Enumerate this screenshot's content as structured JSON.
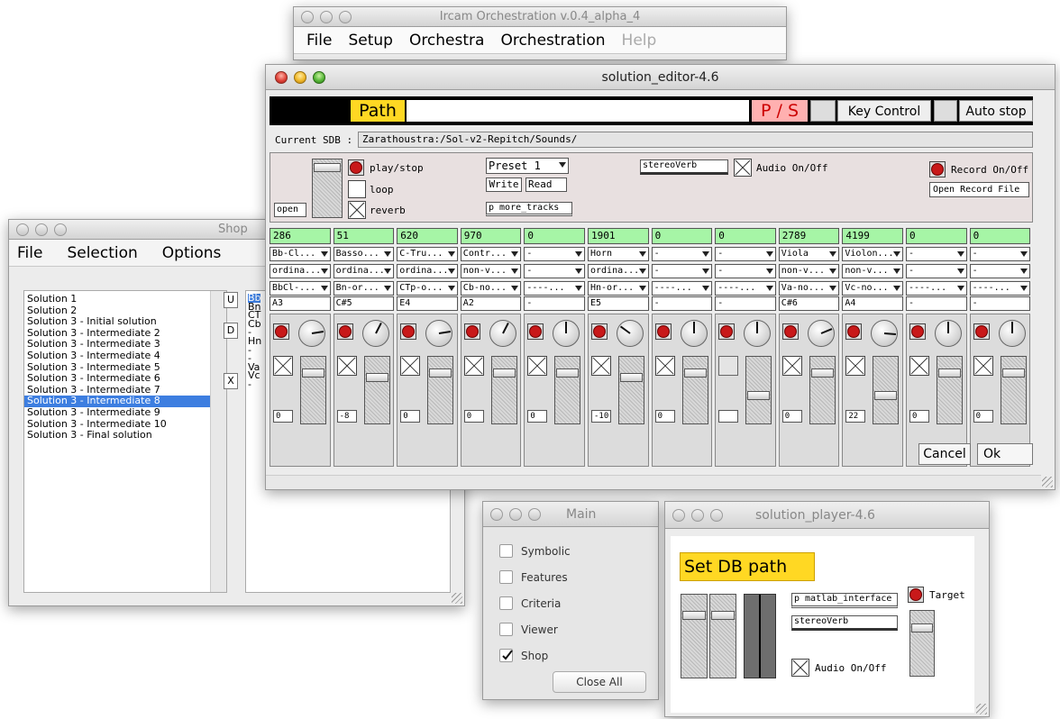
{
  "ircam_window": {
    "title": "Ircam Orchestration v.0.4_alpha_4",
    "menu": [
      "File",
      "Setup",
      "Orchestra",
      "Orchestration",
      "Help"
    ]
  },
  "shop_window": {
    "title": "Shop",
    "menu": [
      "File",
      "Selection",
      "Options"
    ],
    "solutions": [
      "Solution 1",
      "Solution 2",
      "Solution 3 - Initial solution",
      "Solution 3 - Intermediate 2",
      "Solution 3 - Intermediate 3",
      "Solution 3 - Intermediate 4",
      "Solution 3 - Intermediate 5",
      "Solution 3 - Intermediate 6",
      "Solution 3 - Intermediate 7",
      "Solution 3 - Intermediate 8",
      "Solution 3 - Intermediate 9",
      "Solution 3 - Intermediate 10",
      "Solution 3 - Final solution"
    ],
    "selected_index": 9,
    "buttons": {
      "up": "U",
      "down": "D",
      "delete": "X"
    },
    "detail_lines": [
      "Bb",
      "Bn",
      "CT",
      "Cb",
      "-",
      "Hn",
      "-",
      "-",
      "Va",
      "Vc",
      "-"
    ]
  },
  "editor": {
    "title": "solution_editor-4.6",
    "path_label": "Path",
    "path_value": "",
    "ps_label": "P / S",
    "key_control_label": "Key Control",
    "auto_stop_label": "Auto stop",
    "current_sdb_label": "Current SDB :",
    "current_sdb_value": "Zarathoustra:/Sol-v2-Repitch/Sounds/",
    "open_label": "open",
    "play_stop_label": "play/stop",
    "loop_label": "loop",
    "reverb_label": "reverb",
    "preset_value": "Preset 1",
    "write_label": "Write",
    "read_label": "Read",
    "more_tracks_label": "p more_tracks",
    "stereoverb_label": "stereoVerb",
    "audio_onoff_label": "Audio On/Off",
    "record_onoff_label": "Record On/Off",
    "open_record_file_label": "Open Record File",
    "cancel_label": "Cancel",
    "ok_label": "Ok",
    "tracks": [
      {
        "num": "286",
        "instr": "Bb-Cl...",
        "mode": "ordina...",
        "sample": "BbCl-...",
        "note": "A3",
        "value": "0",
        "knob": 0.8,
        "mute": true,
        "fader": 0.8
      },
      {
        "num": "51",
        "instr": "Basso...",
        "mode": "ordina...",
        "sample": "Bn-or...",
        "note": "C#5",
        "value": "-8",
        "knob": 0.6,
        "mute": true,
        "fader": 0.72
      },
      {
        "num": "620",
        "instr": "C-Tru...",
        "mode": "ordina...",
        "sample": "CTp-o...",
        "note": "E4",
        "value": "0",
        "knob": 0.8,
        "mute": true,
        "fader": 0.8
      },
      {
        "num": "970",
        "instr": "Contr...",
        "mode": "non-v...",
        "sample": "Cb-no...",
        "note": "A2",
        "value": "0",
        "knob": 0.6,
        "mute": true,
        "fader": 0.8
      },
      {
        "num": "0",
        "instr": "-",
        "mode": "-",
        "sample": "----...",
        "note": "-",
        "value": "0",
        "knob": 0.5,
        "mute": true,
        "fader": 0.8
      },
      {
        "num": "1901",
        "instr": "Horn",
        "mode": "ordina...",
        "sample": "Hn-or...",
        "note": "E5",
        "value": "-10",
        "knob": 0.3,
        "mute": true,
        "fader": 0.72
      },
      {
        "num": "0",
        "instr": "-",
        "mode": "-",
        "sample": "----...",
        "note": "-",
        "value": "0",
        "knob": 0.5,
        "mute": true,
        "fader": 0.8
      },
      {
        "num": "0",
        "instr": "-",
        "mode": "-",
        "sample": "----...",
        "note": "-",
        "value": "",
        "knob": 0.5,
        "mute": false,
        "fader": 0.4
      },
      {
        "num": "2789",
        "instr": "Viola",
        "mode": "non-v...",
        "sample": "Va-no...",
        "note": "C#6",
        "value": "0",
        "knob": 0.75,
        "mute": true,
        "fader": 0.8
      },
      {
        "num": "4199",
        "instr": "Violon...",
        "mode": "non-v...",
        "sample": "Vc-no...",
        "note": "A4",
        "value": "22",
        "knob": 0.85,
        "mute": true,
        "fader": 0.4
      },
      {
        "num": "0",
        "instr": "-",
        "mode": "-",
        "sample": "----...",
        "note": "-",
        "value": "0",
        "knob": 0.5,
        "mute": true,
        "fader": 0.8
      },
      {
        "num": "0",
        "instr": "-",
        "mode": "-",
        "sample": "----...",
        "note": "-",
        "value": "0",
        "knob": 0.5,
        "mute": true,
        "fader": 0.8
      }
    ]
  },
  "main_window": {
    "title": "Main",
    "items": [
      {
        "label": "Symbolic",
        "checked": false
      },
      {
        "label": "Features",
        "checked": false
      },
      {
        "label": "Criteria",
        "checked": false
      },
      {
        "label": "Viewer",
        "checked": false
      },
      {
        "label": "Shop",
        "checked": true
      }
    ],
    "close_all_label": "Close All"
  },
  "player": {
    "title": "solution_player-4.6",
    "set_db_path_label": "Set DB path",
    "matlab_label": "p matlab_interface",
    "stereoverb_label": "stereoVerb",
    "target_label": "Target",
    "audio_onoff_label": "Audio On/Off"
  },
  "colors": {
    "accent_yellow": "#ffd823",
    "track_header_green": "#a6f5a6",
    "ps_pink": "#ffb0b0",
    "selection_blue": "#3d7ee0",
    "record_red": "#c8191a"
  }
}
